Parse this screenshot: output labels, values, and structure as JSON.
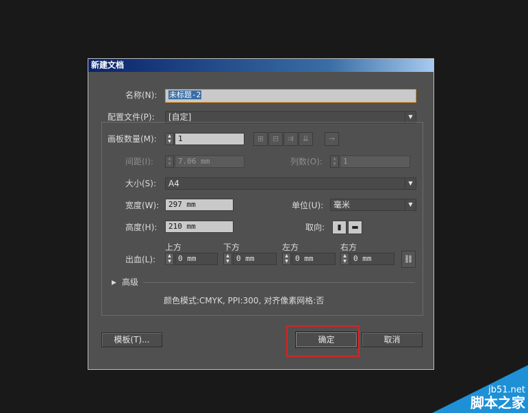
{
  "dialog": {
    "title": "新建文档",
    "name_label": "名称(N):",
    "name_value": "未标题-2",
    "profile_label": "配置文件(P):",
    "profile_value": "[自定]",
    "artboards_label": "画板数量(M):",
    "artboards_value": "1",
    "spacing_label": "间距(I):",
    "spacing_value": "7.06 mm",
    "columns_label": "列数(O):",
    "columns_value": "1",
    "size_label": "大小(S):",
    "size_value": "A4",
    "width_label": "宽度(W):",
    "width_value": "297 mm",
    "units_label": "单位(U):",
    "units_value": "毫米",
    "height_label": "高度(H):",
    "height_value": "210 mm",
    "orientation_label": "取向:",
    "bleed_label": "出血(L):",
    "bleed_top_label": "上方",
    "bleed_bottom_label": "下方",
    "bleed_left_label": "左方",
    "bleed_right_label": "右方",
    "bleed_top_value": "0 mm",
    "bleed_bottom_value": "0 mm",
    "bleed_left_value": "0 mm",
    "bleed_right_value": "0 mm",
    "advanced_label": "高级",
    "summary": "颜色模式:CMYK, PPI:300, 对齐像素网格:否",
    "templates_button": "模板(T)...",
    "ok_button": "确定",
    "cancel_button": "取消"
  },
  "watermark": {
    "domain": "jb51.net",
    "site": "脚本之家"
  },
  "colors": {
    "dialog_bg": "#505050",
    "titlebar": "#0a246a",
    "highlight_box": "#e02020",
    "watermark": "#1e90d6"
  }
}
